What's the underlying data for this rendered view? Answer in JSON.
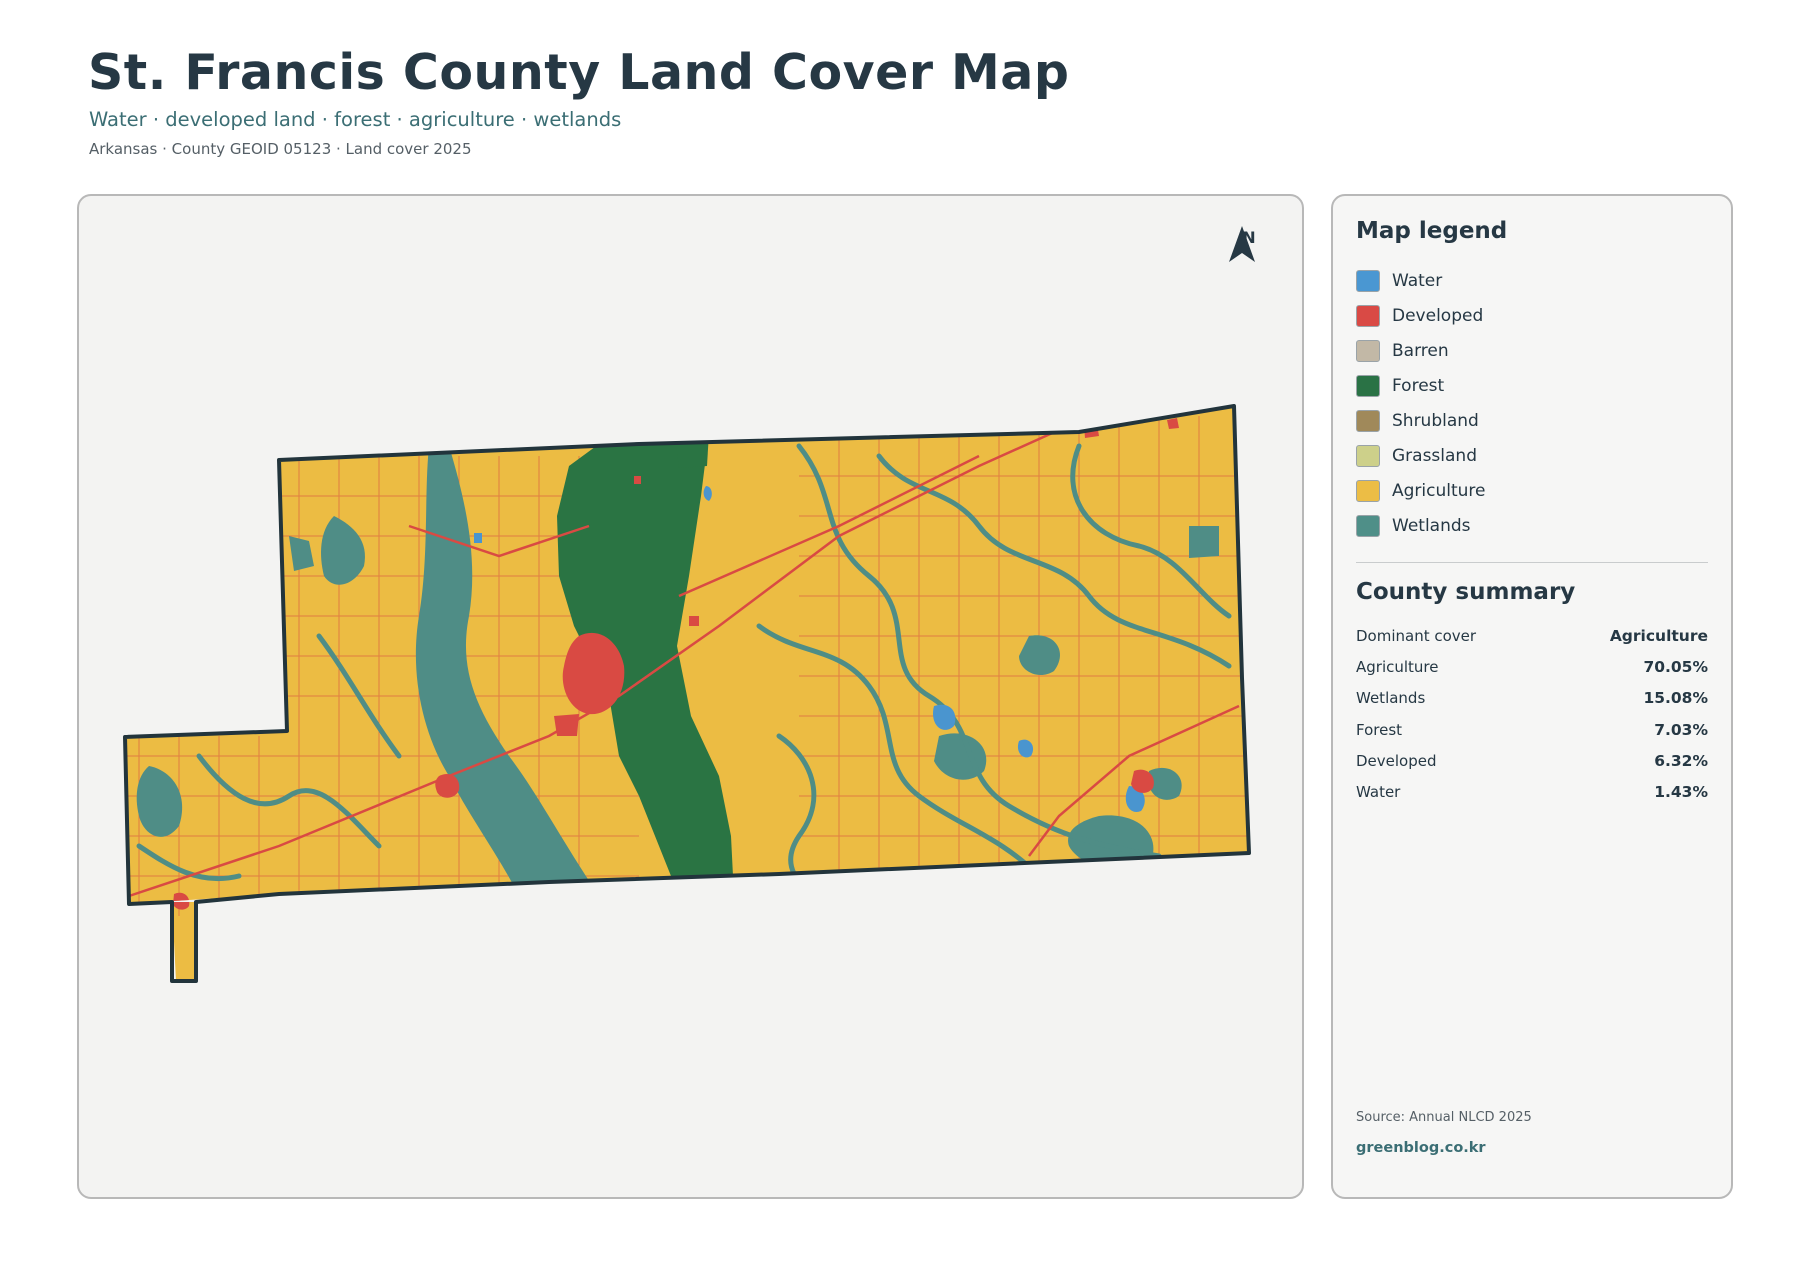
{
  "header": {
    "title": "St. Francis County Land Cover Map",
    "subtitle": "Water · developed land · forest · agriculture · wetlands",
    "meta": "Arkansas · County GEOID 05123 · Land cover 2025"
  },
  "map": {
    "north_label": "N",
    "colors": {
      "agriculture": "#ecbc43",
      "wetlands": "#4f8d86",
      "forest": "#2a7443",
      "developed": "#d94a43",
      "water": "#4a95cf",
      "outline": "#22343c"
    }
  },
  "legend": {
    "title": "Map legend",
    "items": [
      {
        "label": "Water",
        "color": "#4a97d2"
      },
      {
        "label": "Developed",
        "color": "#d94a45"
      },
      {
        "label": "Barren",
        "color": "#c2b8a6"
      },
      {
        "label": "Forest",
        "color": "#2a7245"
      },
      {
        "label": "Shrubland",
        "color": "#a0895a"
      },
      {
        "label": "Grassland",
        "color": "#cdd08a"
      },
      {
        "label": "Agriculture",
        "color": "#ecbd45"
      },
      {
        "label": "Wetlands",
        "color": "#4f8f88"
      }
    ]
  },
  "summary": {
    "title": "County summary",
    "rows": [
      {
        "label": "Dominant cover",
        "value": "Agriculture"
      },
      {
        "label": "Agriculture",
        "value": "70.05%"
      },
      {
        "label": "Wetlands",
        "value": "15.08%"
      },
      {
        "label": "Forest",
        "value": "7.03%"
      },
      {
        "label": "Developed",
        "value": "6.32%"
      },
      {
        "label": "Water",
        "value": "1.43%"
      }
    ]
  },
  "footer": {
    "source": "Source: Annual NLCD 2025",
    "brand": "greenblog.co.kr"
  }
}
